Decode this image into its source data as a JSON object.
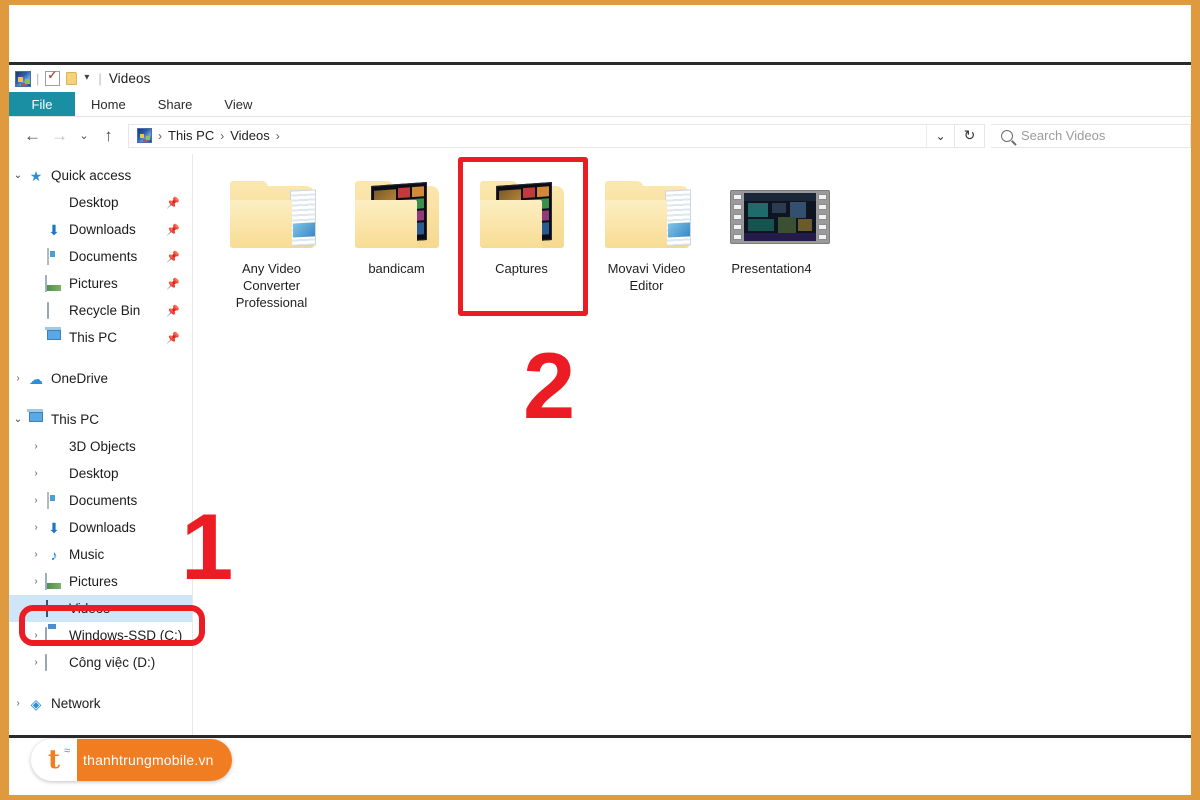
{
  "theme": {
    "frame_border": "#e09a3e",
    "file_tab_accent": "#1a8fa3",
    "selection_blue": "#cfe6f9",
    "annotation_red": "#ec1c24",
    "watermark_orange": "#f07d22"
  },
  "window": {
    "title": "Videos",
    "quick_access_toolbar": [
      {
        "name": "app-icon",
        "label": "Videos"
      },
      {
        "name": "properties-icon",
        "label": "Properties"
      },
      {
        "name": "new-folder-icon",
        "label": "New folder"
      },
      {
        "name": "customize-chevron",
        "label": "▾"
      }
    ]
  },
  "ribbon": {
    "tabs": [
      {
        "label": "File",
        "active": true
      },
      {
        "label": "Home",
        "active": false
      },
      {
        "label": "Share",
        "active": false
      },
      {
        "label": "View",
        "active": false
      }
    ]
  },
  "address_bar": {
    "back_label": "←",
    "forward_label": "→",
    "recent_label": "⌄",
    "up_label": "↑",
    "crumbs": [
      "This PC",
      "Videos"
    ],
    "separator": "›",
    "dropdown_label": "⌄",
    "refresh_label": "↻"
  },
  "search": {
    "placeholder": "Search Videos",
    "value": ""
  },
  "nav_pane": {
    "groups": [
      {
        "name": "quick-access",
        "header": {
          "label": "Quick access",
          "expander": "⌄",
          "icon": "star-icon"
        },
        "items": [
          {
            "label": "Desktop",
            "icon": "desktop-icon",
            "pinned": true
          },
          {
            "label": "Downloads",
            "icon": "download-icon",
            "pinned": true
          },
          {
            "label": "Documents",
            "icon": "document-icon",
            "pinned": true
          },
          {
            "label": "Pictures",
            "icon": "picture-icon",
            "pinned": true
          },
          {
            "label": "Recycle Bin",
            "icon": "recycle-bin-icon",
            "pinned": true
          },
          {
            "label": "This PC",
            "icon": "this-pc-icon",
            "pinned": true
          }
        ]
      },
      {
        "name": "onedrive",
        "header": {
          "label": "OneDrive",
          "expander": "›",
          "icon": "cloud-icon"
        },
        "items": []
      },
      {
        "name": "this-pc",
        "header": {
          "label": "This PC",
          "expander": "⌄",
          "icon": "this-pc-icon"
        },
        "items": [
          {
            "label": "3D Objects",
            "icon": "3d-objects-icon",
            "expander": "›"
          },
          {
            "label": "Desktop",
            "icon": "desktop-icon",
            "expander": "›"
          },
          {
            "label": "Documents",
            "icon": "document-icon",
            "expander": "›"
          },
          {
            "label": "Downloads",
            "icon": "download-icon",
            "expander": "›"
          },
          {
            "label": "Music",
            "icon": "music-icon",
            "expander": "›"
          },
          {
            "label": "Pictures",
            "icon": "picture-icon",
            "expander": "›"
          },
          {
            "label": "Videos",
            "icon": "videos-icon",
            "expander": "›",
            "selected": true
          },
          {
            "label": "Windows-SSD (C:)",
            "icon": "system-drive-icon",
            "expander": "›"
          },
          {
            "label": "Công việc (D:)",
            "icon": "drive-icon",
            "expander": "›"
          }
        ]
      },
      {
        "name": "network",
        "header": {
          "label": "Network",
          "expander": "›",
          "icon": "network-icon"
        },
        "items": []
      }
    ]
  },
  "content": {
    "items": [
      {
        "name": "any-video-converter-professional",
        "label": "Any Video Converter Professional",
        "icon": "folder-with-papers"
      },
      {
        "name": "bandicam",
        "label": "bandicam",
        "icon": "folder-with-preview"
      },
      {
        "name": "captures",
        "label": "Captures",
        "icon": "folder-with-preview",
        "highlighted": true
      },
      {
        "name": "movavi-video-editor",
        "label": "Movavi Video Editor",
        "icon": "folder-with-papers"
      },
      {
        "name": "presentation4",
        "label": "Presentation4",
        "icon": "video-file"
      }
    ]
  },
  "annotations": [
    {
      "name": "step-1-number",
      "label": "1"
    },
    {
      "name": "step-2-number",
      "label": "2"
    }
  ],
  "watermark": {
    "logo_letter": "t",
    "text": "thanhtrungmobile.vn"
  }
}
